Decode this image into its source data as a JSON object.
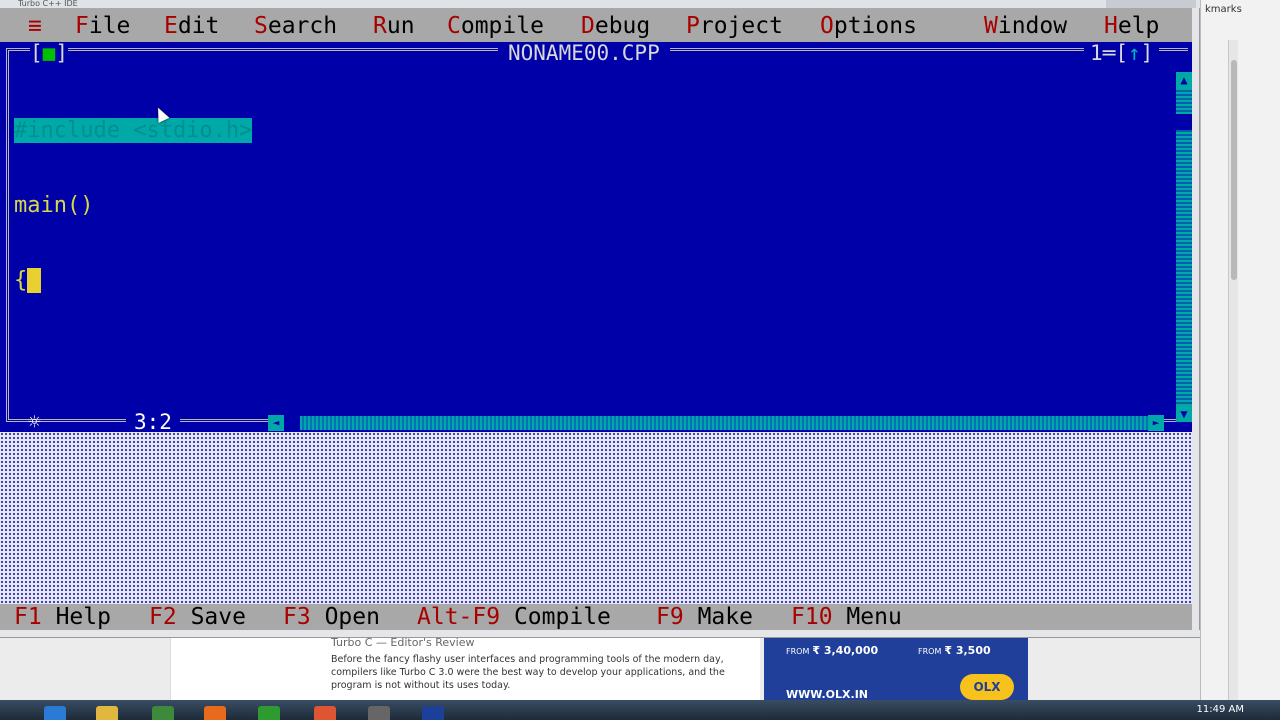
{
  "window": {
    "title": "Turbo C++ IDE"
  },
  "menubar": {
    "system_icon": "≡",
    "items": [
      {
        "label": "File",
        "hotkey": "F",
        "rest": "ile"
      },
      {
        "label": "Edit",
        "hotkey": "E",
        "rest": "dit"
      },
      {
        "label": "Search",
        "hotkey": "S",
        "rest": "earch"
      },
      {
        "label": "Run",
        "hotkey": "R",
        "rest": "un"
      },
      {
        "label": "Compile",
        "hotkey": "C",
        "rest": "ompile"
      },
      {
        "label": "Debug",
        "hotkey": "D",
        "rest": "ebug"
      },
      {
        "label": "Project",
        "hotkey": "P",
        "rest": "roject"
      },
      {
        "label": "Options",
        "hotkey": "O",
        "rest": "ptions"
      },
      {
        "label": "Window",
        "hotkey": "W",
        "rest": "indow"
      },
      {
        "label": "Help",
        "hotkey": "H",
        "rest": "elp"
      }
    ]
  },
  "editor": {
    "filename": "NONAME00.CPP",
    "window_number": "1",
    "close_box_left": "[",
    "close_box_mark": "■",
    "close_box_right": "]",
    "zoom_left": "[",
    "zoom_arrow": "↑",
    "zoom_right": "]",
    "lines": [
      "#include <stdio.h>",
      "main()",
      "{"
    ],
    "cursor_position": "3:2",
    "status_star": "☼"
  },
  "scroll": {
    "up": "▲",
    "down": "▼",
    "left": "◄",
    "right": "►"
  },
  "function_keys": [
    {
      "key": "F1",
      "label": "Help"
    },
    {
      "key": "F2",
      "label": "Save"
    },
    {
      "key": "F3",
      "label": "Open"
    },
    {
      "key": "Alt-F9",
      "label": "Compile"
    },
    {
      "key": "F9",
      "label": "Make"
    },
    {
      "key": "F10",
      "label": "Menu"
    }
  ],
  "background_page": {
    "bookmarks_label": "kmarks",
    "article_heading": "Turbo C — Editor's Review",
    "article_text": "Before the fancy flashy user interfaces and programming tools of the modern day, compilers like Turbo C 3.0 were the best way to develop your applications, and the program is not without its uses today.",
    "ad": {
      "price1_prefix": "FROM",
      "price1": "₹ 3,40,000",
      "price2_prefix": "FROM",
      "price2": "₹ 3,500",
      "url": "WWW.OLX.IN",
      "logo": "OLX"
    }
  },
  "taskbar": {
    "clock": "11:49 AM"
  }
}
